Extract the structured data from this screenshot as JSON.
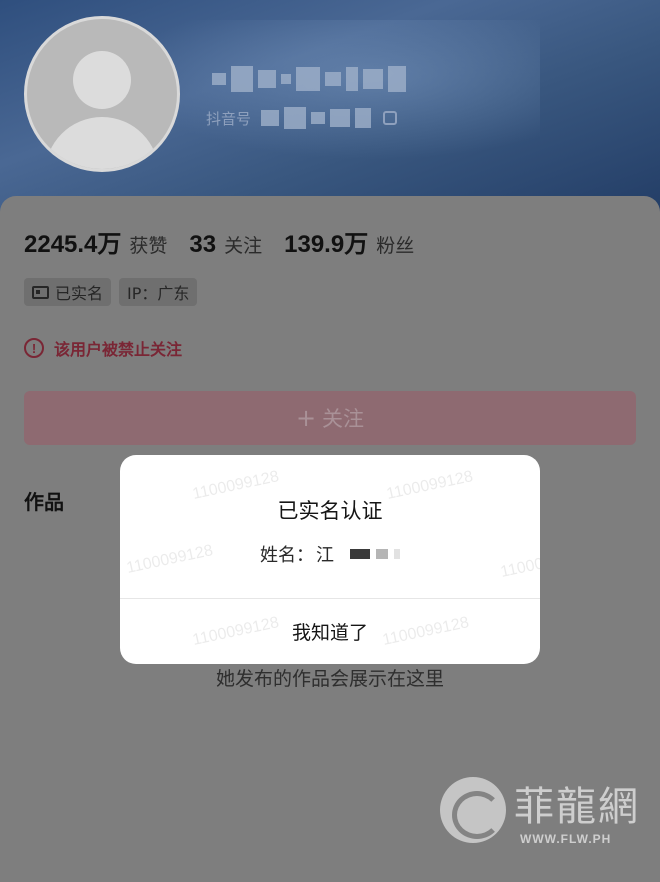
{
  "profile": {
    "id_label": "抖音号"
  },
  "stats": [
    {
      "value": "2245.4万",
      "label": "获赞"
    },
    {
      "value": "33",
      "label": "关注"
    },
    {
      "value": "139.9万",
      "label": "粉丝"
    }
  ],
  "tags": {
    "verified": "已实名",
    "ip": "IP：广东"
  },
  "warning": "该用户被禁止关注",
  "follow_button": {
    "icon": "+",
    "label": "关注"
  },
  "tab_works": "作品",
  "empty_state": "她发布的作品会展示在这里",
  "dialog": {
    "title": "已实名认证",
    "name_label": "姓名：",
    "name_visible": "江",
    "confirm": "我知道了",
    "watermark": "1100099128"
  },
  "site_logo": {
    "name": "菲龍網",
    "url": "WWW.FLW.PH"
  },
  "colors": {
    "warning": "#7a2635",
    "follow_button_bg": "#8e6a71"
  }
}
